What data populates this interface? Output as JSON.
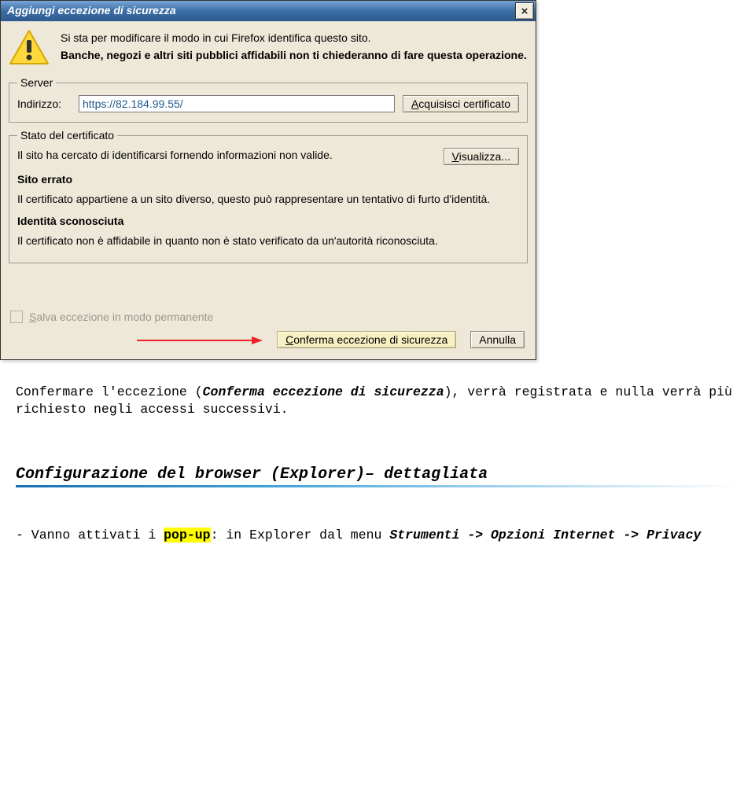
{
  "dialog": {
    "title": "Aggiungi eccezione di sicurezza",
    "close": "×",
    "intro_line1": "Si sta per modificare il modo in cui Firefox identifica questo sito.",
    "intro_line2": "Banche, negozi e altri siti pubblici affidabili non ti chiederanno di fare questa operazione.",
    "server": {
      "legend": "Server",
      "label": "Indirizzo:",
      "value": "https://82.184.99.55/",
      "acquire_btn": "cquisisci certificato"
    },
    "cert": {
      "legend": "Stato del certificato",
      "status_line": "Il sito ha cercato di identificarsi fornendo informazioni non valide.",
      "view_btn": "isualizza...",
      "subhead_site": "Sito errato",
      "para_site": "Il certificato appartiene a un sito diverso, questo può rappresentare un tentativo di furto d'identità.",
      "subhead_ident": "Identità sconosciuta",
      "para_ident": "Il certificato non è affidabile in quanto non è stato verificato da un'autorità riconosciuta."
    },
    "perm_checkbox": "alva eccezione in modo permanente",
    "confirm_btn": "onferma eccezione di sicurezza",
    "cancel_btn": "Annulla"
  },
  "doc": {
    "para1_a": "Confermare l'eccezione (",
    "para1_em": "Conferma eccezione di sicurezza",
    "para1_b": "), verrà registrata e nulla verrà più richiesto negli accessi successivi.",
    "heading": "Configurazione del browser (Explorer)– dettagliata",
    "bullet_prefix": "- Vanno attivati i ",
    "bullet_hl": "pop-up",
    "bullet_after": ": in Explorer dal menu ",
    "menu_path": "Strumenti -> Opzioni Internet -> Privacy"
  }
}
